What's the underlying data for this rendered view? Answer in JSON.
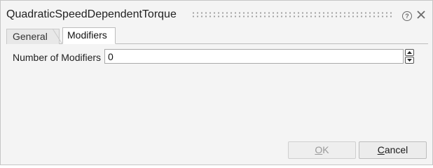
{
  "dialog": {
    "title": "QuadraticSpeedDependentTorque",
    "help_glyph": "?",
    "close_glyph": "✕"
  },
  "tabs": [
    {
      "label": "General",
      "active": false
    },
    {
      "label": "Modifiers",
      "active": true
    }
  ],
  "fields": {
    "number_of_modifiers": {
      "label": "Number of Modifiers",
      "value": "0"
    }
  },
  "buttons": {
    "ok": {
      "mnemonic": "O",
      "rest": "K",
      "enabled": false
    },
    "cancel": {
      "mnemonic": "C",
      "rest": "ancel",
      "enabled": true
    }
  },
  "icons": [
    "help-icon",
    "close-icon",
    "spin-up-icon",
    "spin-down-icon"
  ]
}
